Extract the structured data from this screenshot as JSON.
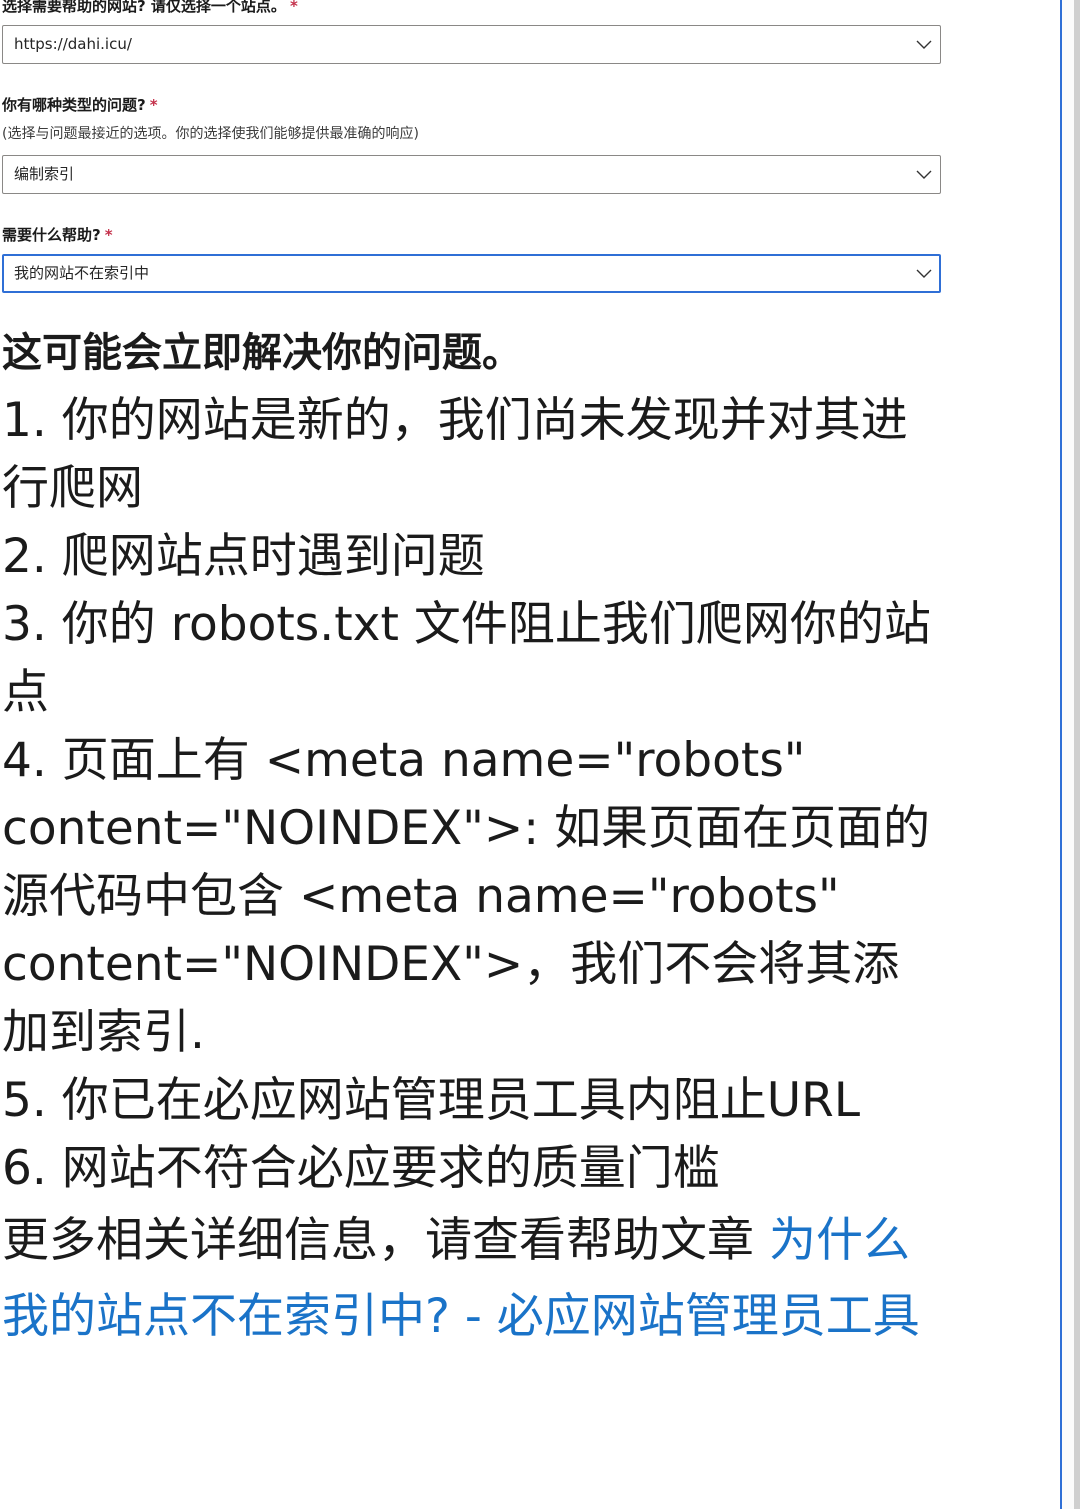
{
  "form": {
    "site": {
      "label": "选择需要帮助的网站? 请仅选择一个站点。",
      "required_mark": "*",
      "value": "https://dahi.icu/"
    },
    "issue_type": {
      "label": "你有哪种类型的问题?",
      "required_mark": "*",
      "hint": "(选择与问题最接近的选项。你的选择使我们能够提供最准确的响应)",
      "value": "编制索引"
    },
    "help": {
      "label": "需要什么帮助?",
      "required_mark": "*",
      "value": "我的网站不在索引中"
    }
  },
  "solution": {
    "heading": "这可能会立即解决你的问题。",
    "items": [
      "1. 你的网站是新的，我们尚未发现并对其进行爬网",
      "2. 爬网站点时遇到问题",
      "3. 你的 robots.txt 文件阻止我们爬网你的站点",
      "4. 页面上有 <meta name=\"robots\" content=\"NOINDEX\">: 如果页面在页面的源代码中包含 <meta name=\"robots\" content=\"NOINDEX\">，我们不会将其添加到索引.",
      "5. 你已在必应网站管理员工具内阻止URL",
      "6. 网站不符合必应要求的质量门槛"
    ],
    "more_prefix": "更多相关详细信息，请查看帮助文章 ",
    "more_link": "为什么我的站点不在索引中? - 必应网站管理员工具"
  },
  "colors": {
    "accent": "#2f6fd6",
    "link": "#1a73c8",
    "required": "#c4314b"
  },
  "icons": {
    "dropdown": "chevron-down-icon"
  }
}
